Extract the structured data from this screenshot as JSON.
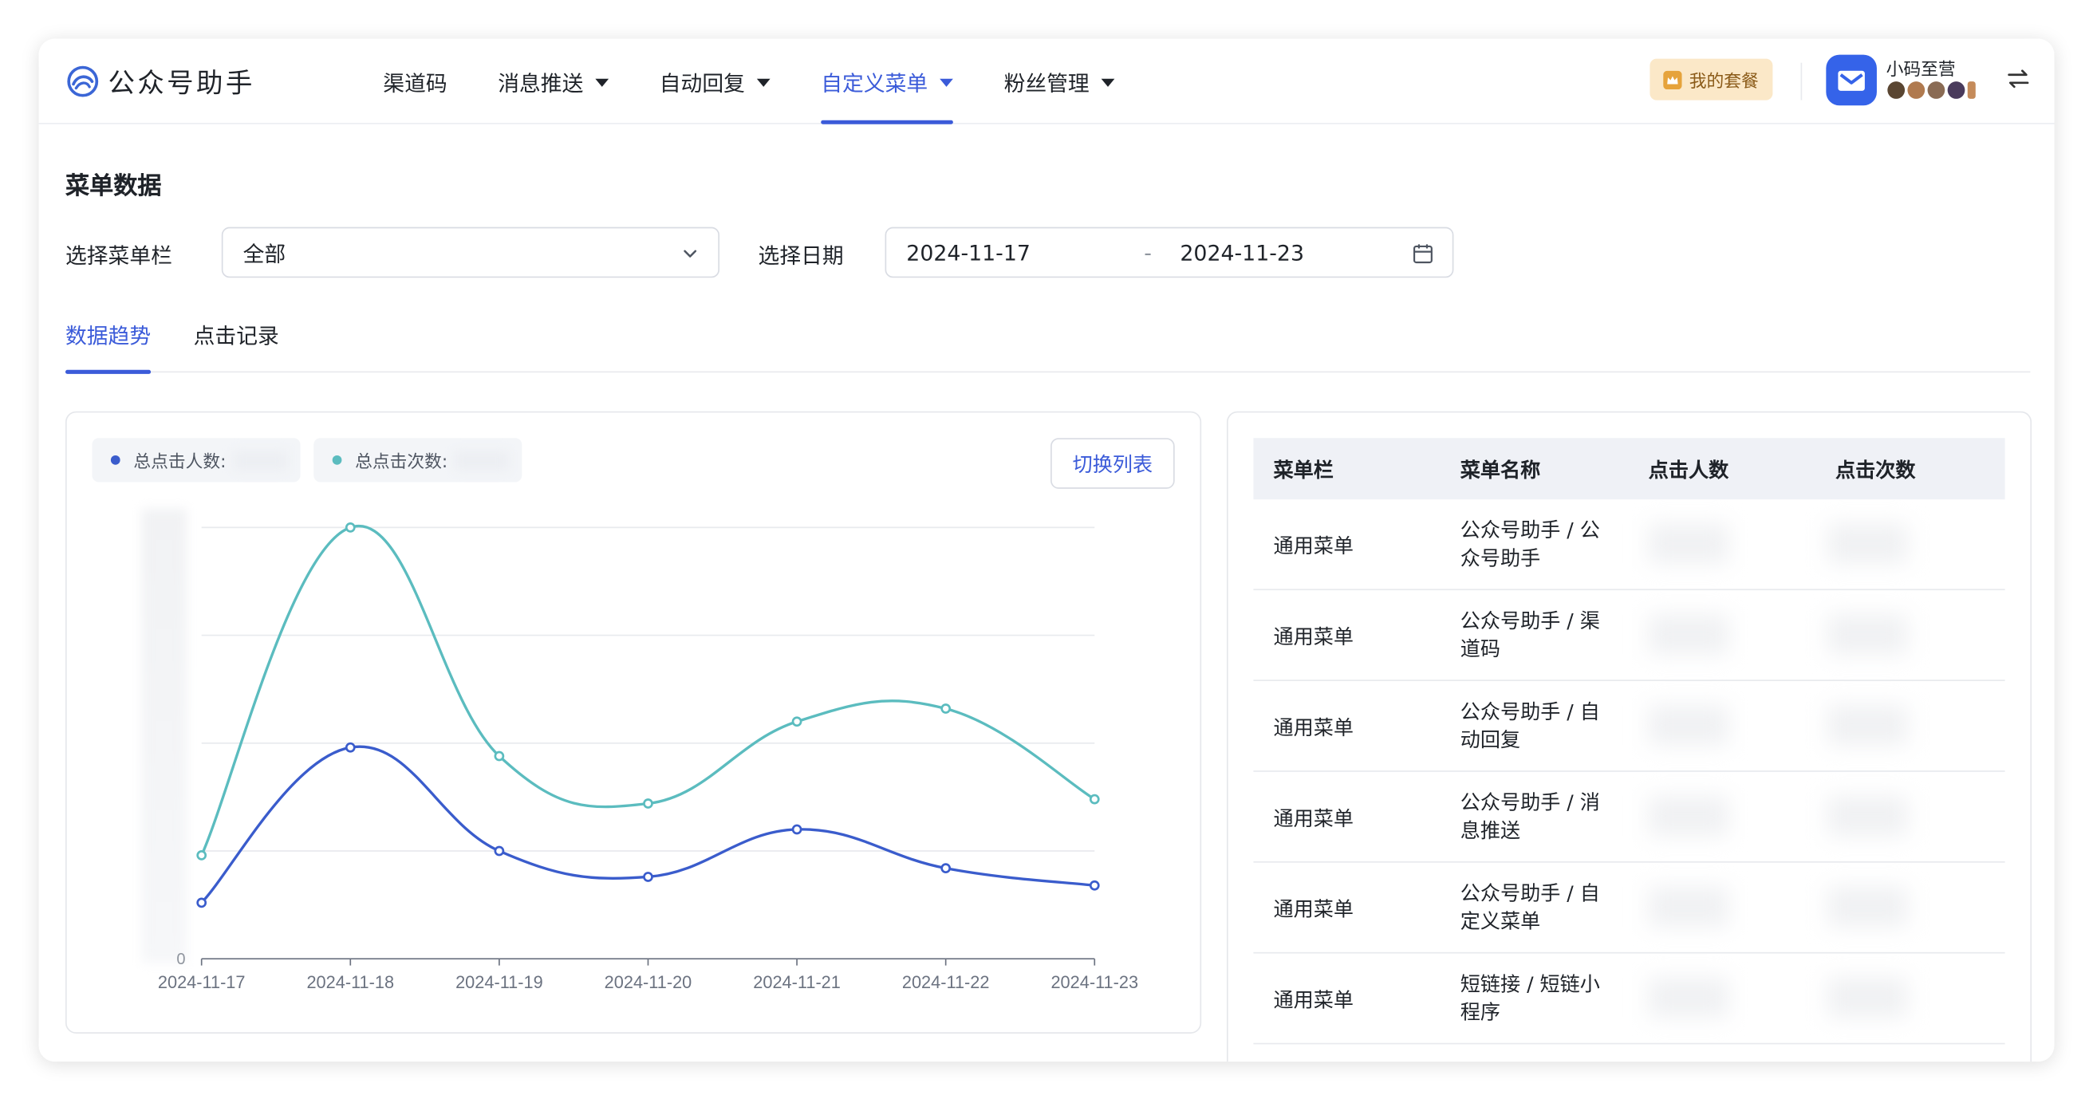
{
  "app": {
    "name": "公众号助手"
  },
  "nav": {
    "items": [
      {
        "label": "渠道码",
        "dropdown": false,
        "active": false
      },
      {
        "label": "消息推送",
        "dropdown": true,
        "active": false
      },
      {
        "label": "自动回复",
        "dropdown": true,
        "active": false
      },
      {
        "label": "自定义菜单",
        "dropdown": true,
        "active": true
      },
      {
        "label": "粉丝管理",
        "dropdown": true,
        "active": false
      }
    ]
  },
  "header": {
    "plan_label": "我的套餐",
    "account_name": "小码至营"
  },
  "page": {
    "title": "菜单数据",
    "menu_select_label": "选择菜单栏",
    "menu_select_value": "全部",
    "date_label": "选择日期",
    "date_start": "2024-11-17",
    "date_separator": "-",
    "date_end": "2024-11-23"
  },
  "tabs": [
    {
      "label": "数据趋势",
      "active": true
    },
    {
      "label": "点击记录",
      "active": false
    }
  ],
  "chart": {
    "legend": [
      {
        "label": "总点击人数:",
        "color": "#3a5ccc"
      },
      {
        "label": "总点击次数:",
        "color": "#5bbcbf"
      }
    ],
    "toggle_label": "切换列表"
  },
  "chart_data": {
    "type": "line",
    "x": [
      "2024-11-17",
      "2024-11-18",
      "2024-11-19",
      "2024-11-20",
      "2024-11-21",
      "2024-11-22",
      "2024-11-23"
    ],
    "series": [
      {
        "name": "总点击人数",
        "color": "#3a5ccc",
        "values": [
          0.13,
          0.49,
          0.25,
          0.19,
          0.3,
          0.21,
          0.17
        ]
      },
      {
        "name": "总点击次数",
        "color": "#5bbcbf",
        "values": [
          0.24,
          1.0,
          0.47,
          0.36,
          0.55,
          0.58,
          0.37
        ]
      }
    ],
    "y_tick_labels_shown": [
      "0"
    ],
    "ylim": [
      0,
      1
    ],
    "grid": true,
    "note_y_values": "y-axis tick labels are blurred; values are relative to the top gridline"
  },
  "table": {
    "columns": [
      "菜单栏",
      "菜单名称",
      "点击人数",
      "点击次数"
    ],
    "rows": [
      {
        "bar": "通用菜单",
        "name": "公众号助手 / 公众号助手"
      },
      {
        "bar": "通用菜单",
        "name": "公众号助手 / 渠道码"
      },
      {
        "bar": "通用菜单",
        "name": "公众号助手 / 自动回复"
      },
      {
        "bar": "通用菜单",
        "name": "公众号助手 / 消息推送"
      },
      {
        "bar": "通用菜单",
        "name": "公众号助手 / 自定义菜单"
      },
      {
        "bar": "通用菜单",
        "name": "短链接 / 短链小程序"
      }
    ]
  },
  "colors": {
    "accent": "#3b5bd9",
    "series_people": "#3a5ccc",
    "series_clicks": "#5bbcbf",
    "plan_bg": "#fbe8c8"
  }
}
